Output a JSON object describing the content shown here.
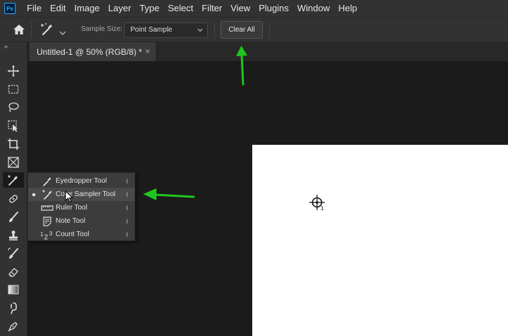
{
  "app": {
    "logo_text": "Ps"
  },
  "menu": [
    "File",
    "Edit",
    "Image",
    "Layer",
    "Type",
    "Select",
    "Filter",
    "View",
    "Plugins",
    "Window",
    "Help"
  ],
  "options_bar": {
    "sample_size_label": "Sample Size:",
    "sample_size_value": "Point Sample",
    "clear_all_label": "Clear All"
  },
  "toolbar": {
    "collapse_glyph": "»"
  },
  "document_tab": {
    "title": "Untitled-1 @ 50% (RGB/8) *",
    "close_glyph": "×"
  },
  "flyout": {
    "items": [
      {
        "label": "Eyedropper Tool",
        "shortcut": "I",
        "icon": "eyedropper-icon",
        "selected": false
      },
      {
        "label": "Color Sampler Tool",
        "shortcut": "I",
        "icon": "color-sampler-icon",
        "selected": true
      },
      {
        "label": "Ruler Tool",
        "shortcut": "I",
        "icon": "ruler-icon",
        "selected": false
      },
      {
        "label": "Note Tool",
        "shortcut": "I",
        "icon": "note-icon",
        "selected": false
      },
      {
        "label": "Count Tool",
        "shortcut": "I",
        "icon": "count-icon",
        "selected": false
      }
    ]
  },
  "canvas": {
    "sampler_index": "1"
  },
  "colors": {
    "ui_panel": "#323232",
    "canvas_bg": "#1b1b1b",
    "document": "#ffffff",
    "annotation_arrow": "#1ec71e"
  }
}
